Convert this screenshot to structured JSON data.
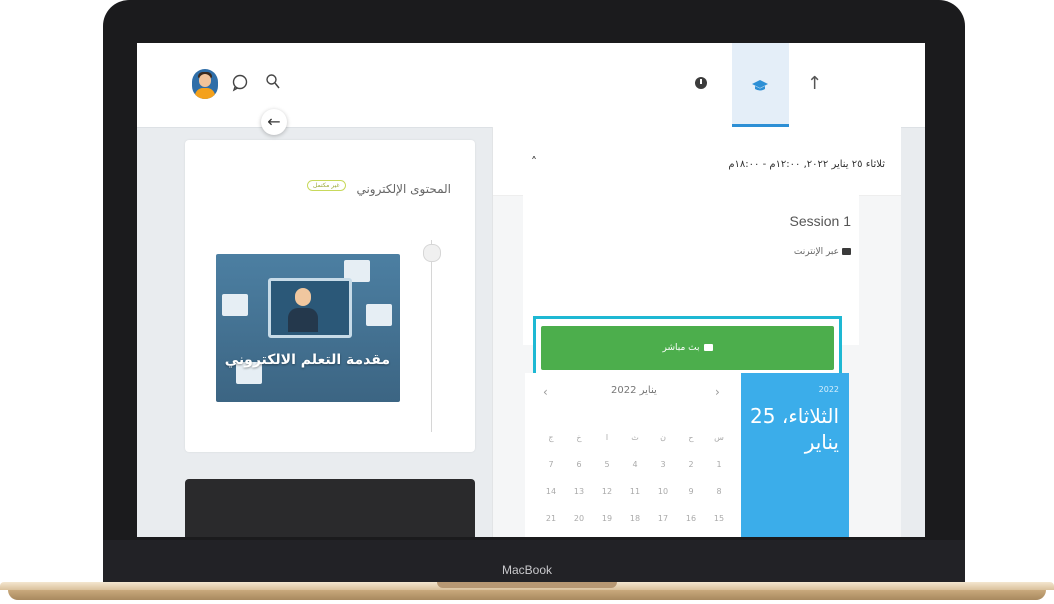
{
  "device": {
    "brand_label": "MacBook"
  },
  "header": {
    "icons": [
      "user-avatar",
      "chat-icon",
      "search-icon",
      "clock-icon",
      "graduation-cap-icon",
      "arrow-up-icon"
    ],
    "active_tab": "graduation-cap-icon",
    "accent_color": "#2d8fd5"
  },
  "content_card": {
    "title": "المحتوى الإلكتروني",
    "status_badge": "غير مكتمل",
    "thumbnail_title": "مقدمة التعلم الالكتروني"
  },
  "session": {
    "datetime": "ثلاثاء ٢٥ يناير ٢٠٢٢, ١٢:٠٠م - ١٨:٠٠م",
    "title": "Session 1",
    "mode_label": "عبر الإنترنت",
    "live_button_label": "بث مباشر",
    "live_button_color": "#4cae4c",
    "highlight_color": "#1eb8d3"
  },
  "calendar": {
    "month_label": "يناير 2022",
    "prev_icon": "chevron-left-icon",
    "next_icon": "chevron-right-icon",
    "weekday_headers": [
      "ج",
      "خ",
      "ا",
      "ث",
      "ن",
      "ح",
      "س"
    ],
    "weeks": [
      [
        "7",
        "6",
        "5",
        "4",
        "3",
        "2",
        "1"
      ],
      [
        "14",
        "13",
        "12",
        "11",
        "10",
        "9",
        "8"
      ],
      [
        "21",
        "20",
        "19",
        "18",
        "17",
        "16",
        "15"
      ]
    ],
    "selected_year": "2022",
    "selected_date": "الثلاثاء، 25 يناير",
    "side_color": "#3badea"
  }
}
